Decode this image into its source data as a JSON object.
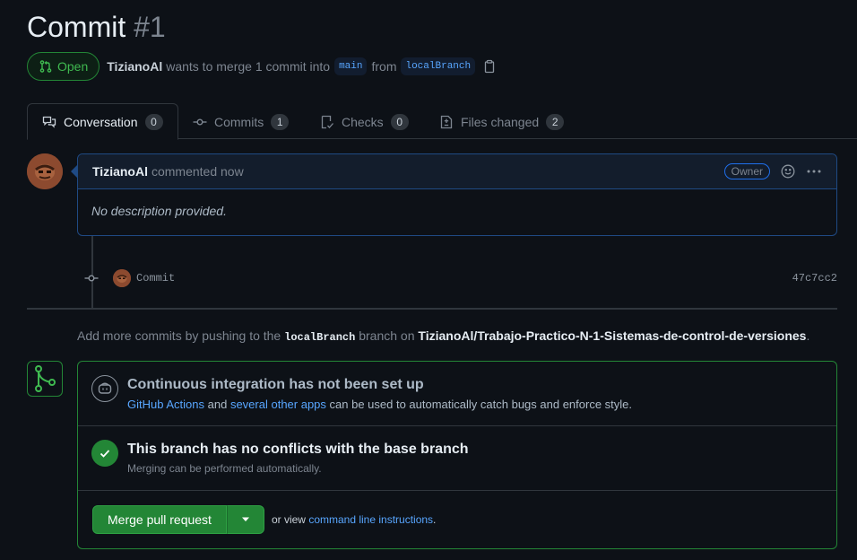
{
  "pr": {
    "title": "Commit",
    "number": "#1",
    "state": "Open",
    "author": "TizianoAl",
    "merge_text": "wants to merge 1 commit into",
    "base_branch": "main",
    "from_text": "from",
    "head_branch": "localBranch"
  },
  "tabs": [
    {
      "label": "Conversation",
      "count": "0",
      "icon": "comment-discussion-icon"
    },
    {
      "label": "Commits",
      "count": "1",
      "icon": "git-commit-icon"
    },
    {
      "label": "Checks",
      "count": "0",
      "icon": "checklist-icon"
    },
    {
      "label": "Files changed",
      "count": "2",
      "icon": "file-diff-icon"
    }
  ],
  "comment": {
    "author": "TizianoAl",
    "action": "commented now",
    "badge": "Owner",
    "body": "No description provided."
  },
  "commit": {
    "message": "Commit",
    "sha": "47c7cc2"
  },
  "push_note": {
    "prefix": "Add more commits by pushing to the",
    "branch": "localBranch",
    "middle": "branch on",
    "repo": "TizianoAl/Trabajo-Practico-N-1-Sistemas-de-control-de-versiones",
    "suffix": "."
  },
  "ci": {
    "title": "Continuous integration has not been set up",
    "link1": "GitHub Actions",
    "and": "and",
    "link2": "several other apps",
    "rest": "can be used to automatically catch bugs and enforce style."
  },
  "conflicts": {
    "title": "This branch has no conflicts with the base branch",
    "subtitle": "Merging can be performed automatically."
  },
  "merge": {
    "button": "Merge pull request",
    "alt_prefix": "or view",
    "alt_link": "command line instructions",
    "alt_suffix": "."
  },
  "colors": {
    "accent_green": "#238636",
    "link_blue": "#58a6ff",
    "background": "#0d1117"
  }
}
